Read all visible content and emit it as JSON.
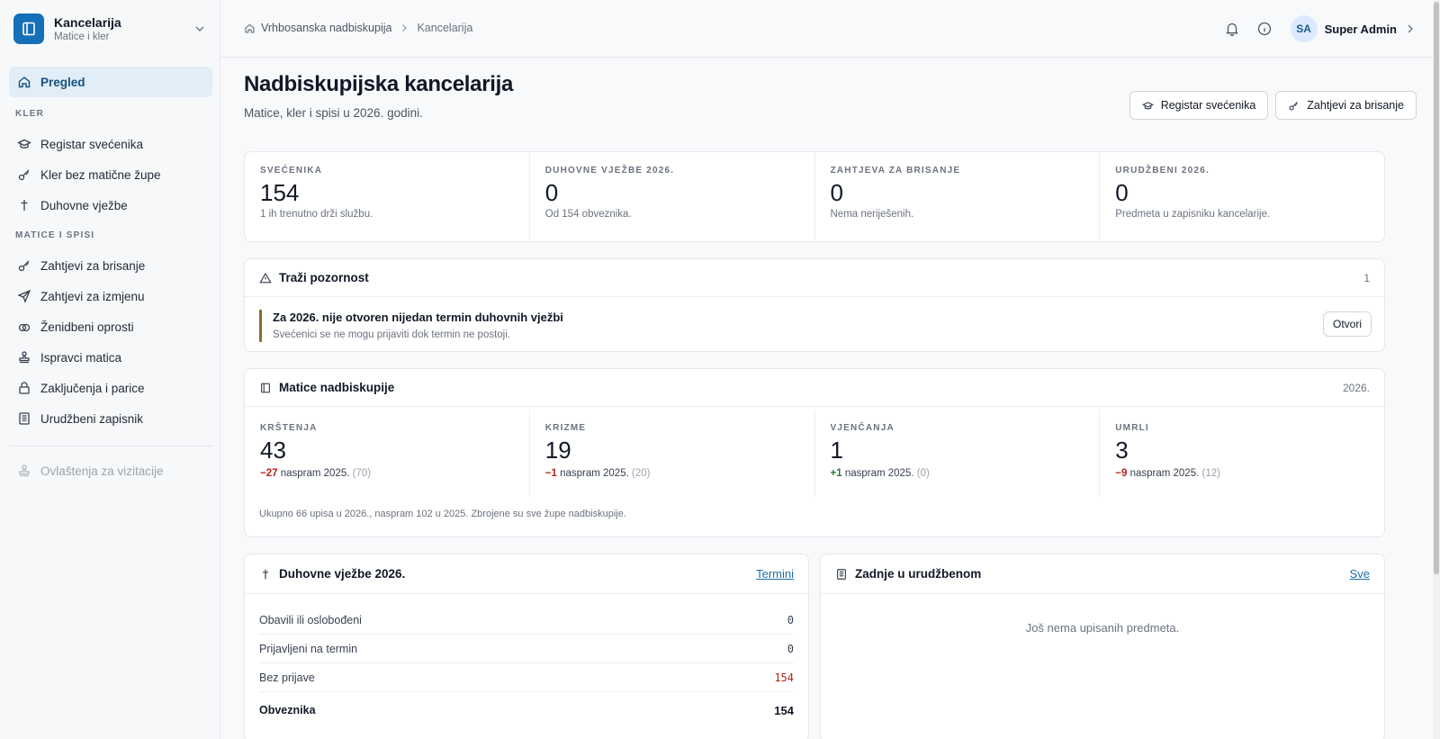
{
  "app": {
    "title": "Kancelarija",
    "subtitle": "Matice i kler"
  },
  "sidebar": {
    "overview": "Pregled",
    "sections": [
      {
        "label": "KLER",
        "items": [
          {
            "label": "Registar svećenika",
            "icon": "graduation-cap-icon"
          },
          {
            "label": "Kler bez matične župe",
            "icon": "key-icon"
          },
          {
            "label": "Duhovne vježbe",
            "icon": "cross-icon"
          }
        ]
      },
      {
        "label": "MATICE I SPISI",
        "items": [
          {
            "label": "Zahtjevi za brisanje",
            "icon": "key-icon"
          },
          {
            "label": "Zahtjevi za izmjenu",
            "icon": "send-icon"
          },
          {
            "label": "Ženidbeni oprosti",
            "icon": "rings-icon"
          },
          {
            "label": "Ispravci matica",
            "icon": "stamp-icon"
          },
          {
            "label": "Zaključenja i parice",
            "icon": "lock-icon"
          },
          {
            "label": "Urudžbeni zapisnik",
            "icon": "register-book-icon"
          }
        ]
      }
    ],
    "disabled_item": {
      "label": "Ovlaštenja za vizitacije",
      "icon": "stamp-icon"
    }
  },
  "topbar": {
    "breadcrumb": [
      "Vrhbosanska nadbiskupija",
      "Kancelarija"
    ],
    "user": {
      "initials": "SA",
      "name": "Super Admin"
    }
  },
  "header": {
    "title": "Nadbiskupijska kancelarija",
    "subtitle": "Matice, kler i spisi u 2026. godini.",
    "buttons": [
      "Registar svećenika",
      "Zahtjevi za brisanje"
    ]
  },
  "stats": [
    {
      "label": "SVEĆENIKA",
      "value": "154",
      "note": "1 ih trenutno drži službu."
    },
    {
      "label": "DUHOVNE VJEŽBE 2026.",
      "value": "0",
      "note": "Od 154 obveznika."
    },
    {
      "label": "ZAHTJEVA ZA BRISANJE",
      "value": "0",
      "note": "Nema neriješenih."
    },
    {
      "label": "URUDŽBENI 2026.",
      "value": "0",
      "note": "Predmeta u zapisniku kancelarije."
    }
  ],
  "attention": {
    "title": "Traži pozornost",
    "count": "1",
    "item_title": "Za 2026. nije otvoren nijedan termin duhovnih vježbi",
    "item_sub": "Svećenici se ne mogu prijaviti dok termin ne postoji.",
    "button": "Otvori",
    "accent": "#8a6d2a"
  },
  "matice": {
    "title": "Matice nadbiskupije",
    "year": "2026.",
    "items": [
      {
        "label": "KRŠTENJA",
        "value": "43",
        "delta": "−27",
        "vs": "naspram 2025.",
        "prev": "(70)",
        "trend": "neg"
      },
      {
        "label": "KRIZME",
        "value": "19",
        "delta": "−1",
        "vs": "naspram 2025.",
        "prev": "(20)",
        "trend": "neg"
      },
      {
        "label": "VJENČANJA",
        "value": "1",
        "delta": "+1",
        "vs": "naspram 2025.",
        "prev": "(0)",
        "trend": "pos"
      },
      {
        "label": "UMRLI",
        "value": "3",
        "delta": "−9",
        "vs": "naspram 2025.",
        "prev": "(12)",
        "trend": "neg"
      }
    ],
    "footnote": "Ukupno 66 upisa u 2026., naspram 102 u 2025. Zbrojene su sve župe nadbiskupije."
  },
  "retreats": {
    "title": "Duhovne vježbe 2026.",
    "link": "Termini",
    "rows": [
      {
        "label": "Obavili ili oslobođeni",
        "value": "0"
      },
      {
        "label": "Prijavljeni na termin",
        "value": "0"
      },
      {
        "label": "Bez prijave",
        "value": "154"
      }
    ],
    "total": {
      "label": "Obveznika",
      "value": "154"
    }
  },
  "registry": {
    "title": "Zadnje u urudžbenom",
    "link": "Sve",
    "empty": "Još nema upisanih predmeta."
  },
  "colors": {
    "brand": "#1470b8",
    "active_bg": "#e1eef8",
    "negative": "#b42318",
    "positive": "#1f7a3d"
  }
}
